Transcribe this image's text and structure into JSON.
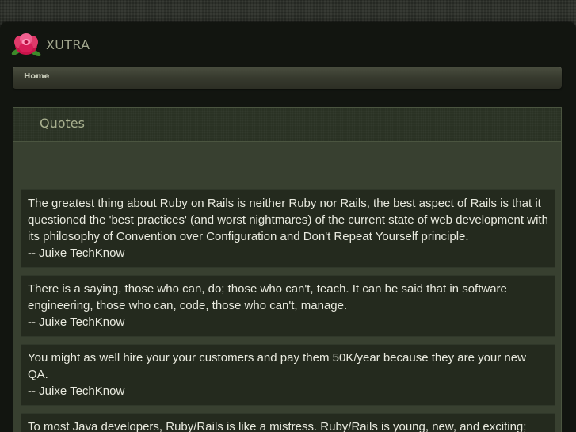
{
  "site": {
    "name": "XUTRA",
    "logo_icon": "rose-flower-icon"
  },
  "nav": {
    "items": [
      {
        "label": "Home"
      }
    ]
  },
  "section": {
    "title": "Quotes"
  },
  "quotes": [
    {
      "text": "The greatest thing about Ruby on Rails is neither Ruby nor Rails, the best aspect of Rails is that it questioned the 'best practices' (and worst nightmares) of the current state of web development with its philosophy of Convention over Configuration and Don't Repeat Yourself principle.",
      "author": "-- Juixe TechKnow"
    },
    {
      "text": "There is a saying, those who can, do; those who can't, teach. It can be said that in software engineering, those who can, code, those who can't, manage.",
      "author": "-- Juixe TechKnow"
    },
    {
      "text": "You might as well hire your your customers and pay them 50K/year because they are your new QA.",
      "author": "-- Juixe TechKnow"
    },
    {
      "text": "To most Java developers, Ruby/Rails is like a mistress. Ruby/Rails is young, new, and exciting;",
      "author": ""
    }
  ],
  "colors": {
    "page_background": "#2e312b",
    "container": "#121510",
    "content_panel": "#384030",
    "quote_box": "#242a1e",
    "quote_text": "#e9eadf",
    "title_text": "#a9b08f"
  }
}
